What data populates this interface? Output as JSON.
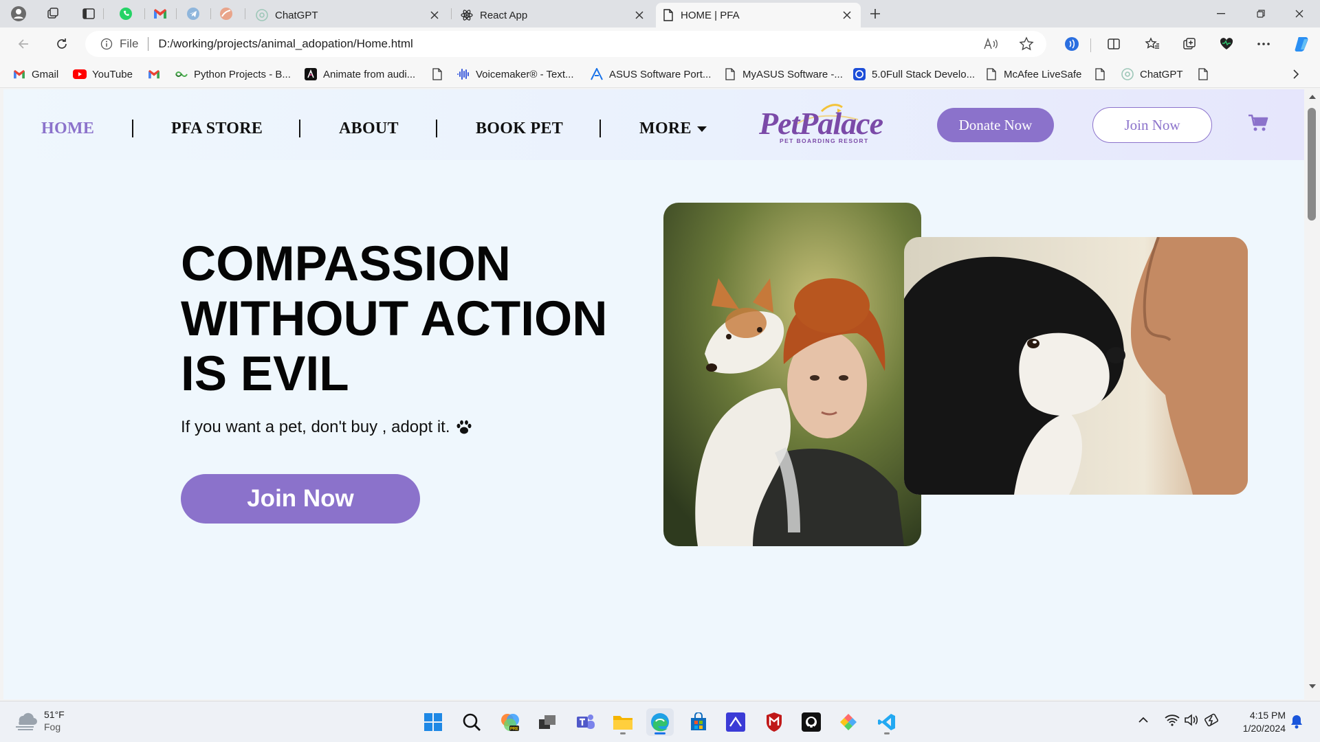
{
  "colors": {
    "accent": "#8b72cb",
    "page_bg": "#eff7fd",
    "nav_active": "#8b72cb",
    "logo_purple": "#7b4aa8",
    "logo_yellow": "#f3c33a"
  },
  "browser": {
    "tabs": [
      {
        "title": "ChatGPT",
        "icon": "chatgpt-icon"
      },
      {
        "title": "React App",
        "icon": "react-icon"
      },
      {
        "title": "HOME | PFA",
        "icon": "page-icon",
        "active": true
      }
    ],
    "address": {
      "scheme_label": "File",
      "url": "D:/working/projects/animal_adopation/Home.html"
    },
    "bookmarks": [
      {
        "label": "Gmail",
        "icon": "gmail-icon"
      },
      {
        "label": "YouTube",
        "icon": "youtube-icon"
      },
      {
        "label": "",
        "icon": "gmail-icon"
      },
      {
        "label": "Python Projects - B...",
        "icon": "python-projects-icon"
      },
      {
        "label": "Animate from audi...",
        "icon": "animate-icon"
      },
      {
        "label": "",
        "icon": "page-icon"
      },
      {
        "label": "Voicemaker® - Text...",
        "icon": "voicemaker-icon"
      },
      {
        "label": "ASUS Software Port...",
        "icon": "asus-icon"
      },
      {
        "label": "MyASUS Software -...",
        "icon": "page-icon"
      },
      {
        "label": "5.0Full Stack Develo...",
        "icon": "course-icon"
      },
      {
        "label": "McAfee LiveSafe",
        "icon": "page-icon"
      },
      {
        "label": "",
        "icon": "page-icon"
      },
      {
        "label": "ChatGPT",
        "icon": "chatgpt-icon"
      },
      {
        "label": "",
        "icon": "page-icon"
      }
    ]
  },
  "site": {
    "nav": {
      "items": [
        {
          "label": "HOME",
          "active": true
        },
        {
          "label": "PFA STORE"
        },
        {
          "label": "ABOUT"
        },
        {
          "label": "BOOK PET"
        },
        {
          "label": "MORE"
        }
      ],
      "logo": {
        "title": "PetPalace",
        "tagline": "PET BOARDING RESORT"
      },
      "donate_label": "Donate Now",
      "join_label": "Join Now",
      "cart_icon": "shopping-cart-icon"
    },
    "hero": {
      "title_lines": [
        "COMPASSION",
        "WITHOUT ACTION",
        "IS EVIL"
      ],
      "subtitle": "If you want a pet, don't buy , adopt it.",
      "subtitle_icon": "paw-icon",
      "cta_label": "Join Now",
      "images": [
        {
          "name": "girl-with-puppy-photo"
        },
        {
          "name": "man-with-puppy-photo"
        }
      ]
    }
  },
  "taskbar": {
    "weather": {
      "temp": "51°F",
      "condition": "Fog"
    },
    "clock": {
      "time": "4:15 PM",
      "date": "1/20/2024"
    },
    "apps": [
      "windows-start-icon",
      "search-icon",
      "copilot-icon",
      "task-view-icon",
      "teams-icon",
      "file-explorer-icon",
      "edge-icon",
      "microsoft-store-icon",
      "vscode-insiders-icon",
      "mcafee-icon",
      "github-icon",
      "git-icon",
      "vscode-icon"
    ]
  }
}
